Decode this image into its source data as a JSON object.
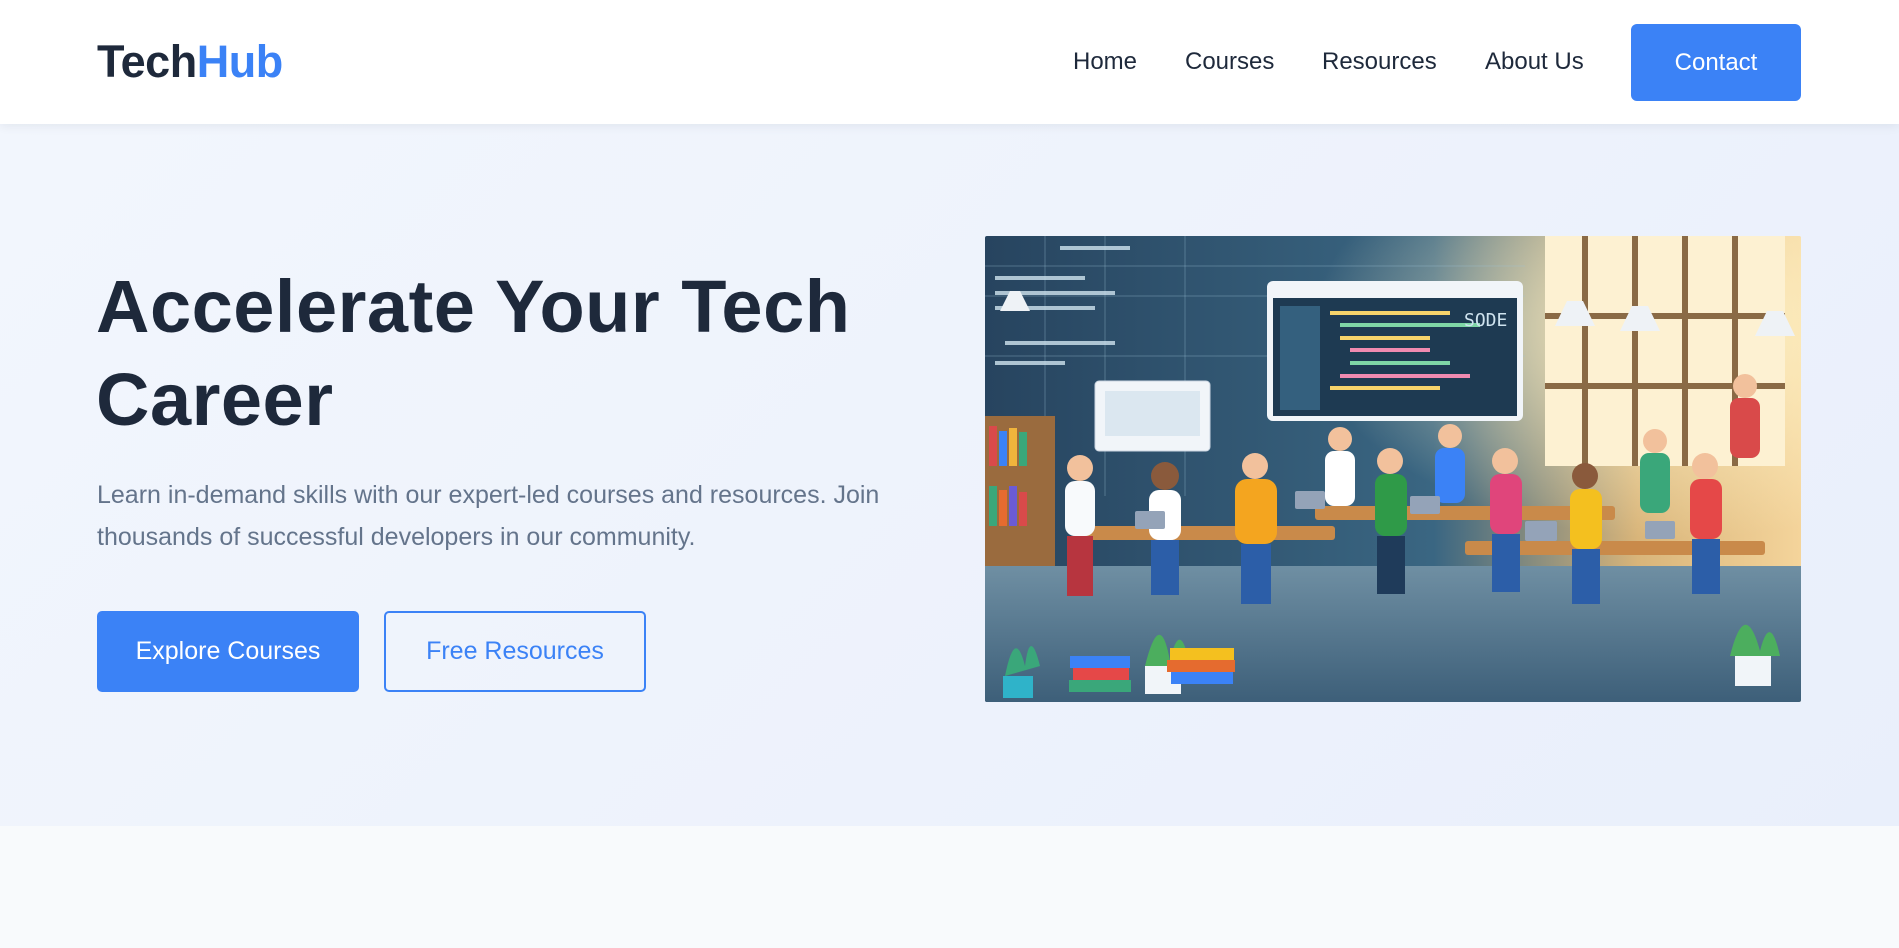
{
  "brand": {
    "name_part1": "Tech",
    "name_part2": "Hub",
    "accent_color": "#3b82f6"
  },
  "nav": {
    "items": [
      "Home",
      "Courses",
      "Resources",
      "About Us"
    ],
    "contact_label": "Contact"
  },
  "hero": {
    "title": "Accelerate Your Tech Career",
    "description": "Learn in-demand skills with our expert-led courses and resources. Join thousands of successful developers in our community.",
    "primary_cta": "Explore Courses",
    "secondary_cta": "Free Resources",
    "image_sign": "SODE"
  },
  "colors": {
    "text_dark": "#1e293b",
    "text_muted": "#64748b",
    "primary": "#3b82f6"
  }
}
